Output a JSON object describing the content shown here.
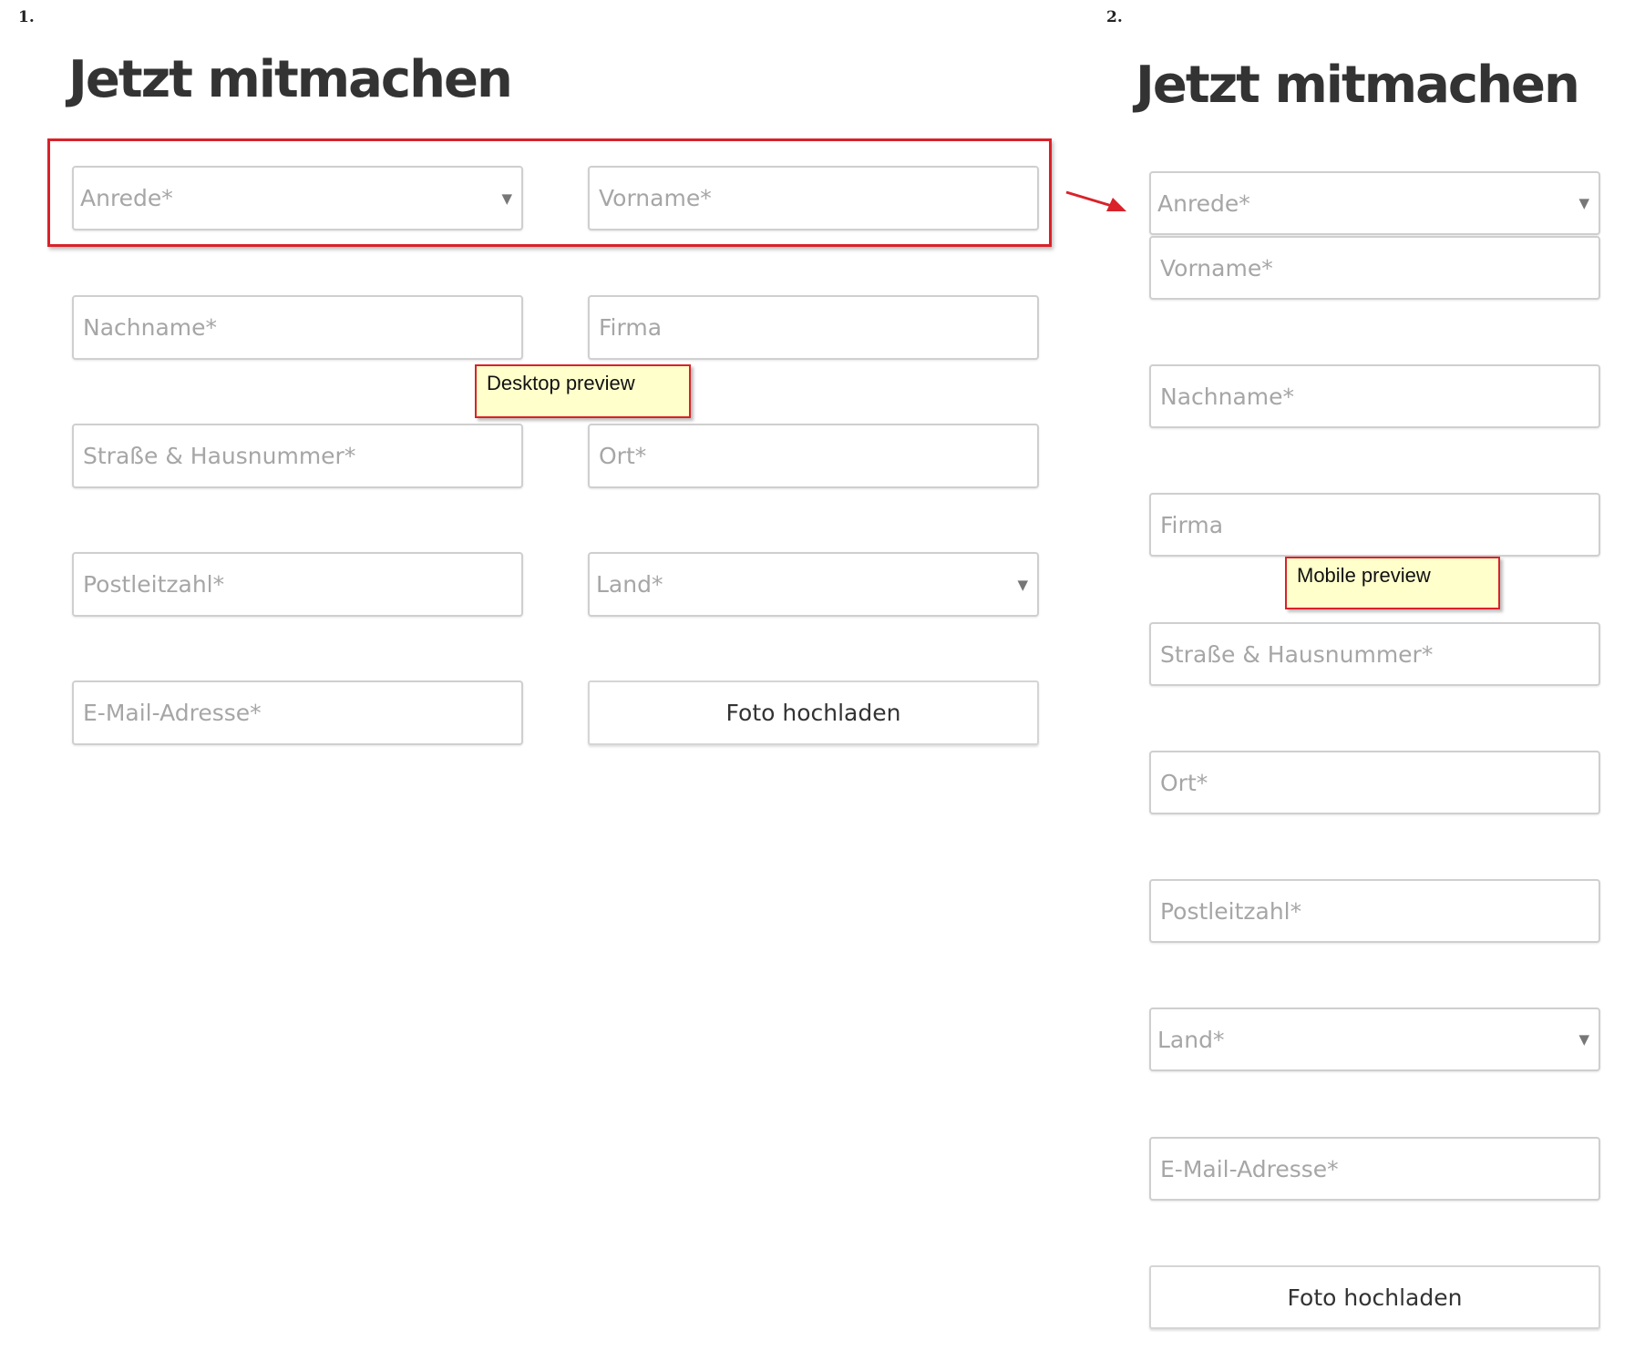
{
  "desktop": {
    "number": "1.",
    "title": "Jetzt mitmachen",
    "fields": {
      "anrede": "Anrede*",
      "vorname": "Vorname*",
      "nachname": "Nachname*",
      "firma": "Firma",
      "strasse": "Straße & Hausnummer*",
      "ort": "Ort*",
      "plz": "Postleitzahl*",
      "land": "Land*",
      "email": "E-Mail-Adresse*"
    },
    "upload_label": "Foto hochladen",
    "note": "Desktop preview"
  },
  "mobile": {
    "number": "2.",
    "title": "Jetzt mitmachen",
    "fields": {
      "anrede": "Anrede*",
      "vorname": "Vorname*",
      "nachname": "Nachname*",
      "firma": "Firma",
      "strasse": "Straße & Hausnummer*",
      "ort": "Ort*",
      "plz": "Postleitzahl*",
      "land": "Land*",
      "email": "E-Mail-Adresse*"
    },
    "upload_label": "Foto hochladen",
    "note": "Mobile preview"
  },
  "caret_glyph": "▼",
  "colors": {
    "annotation_red": "#d9222a",
    "note_background": "#ffffcc"
  }
}
